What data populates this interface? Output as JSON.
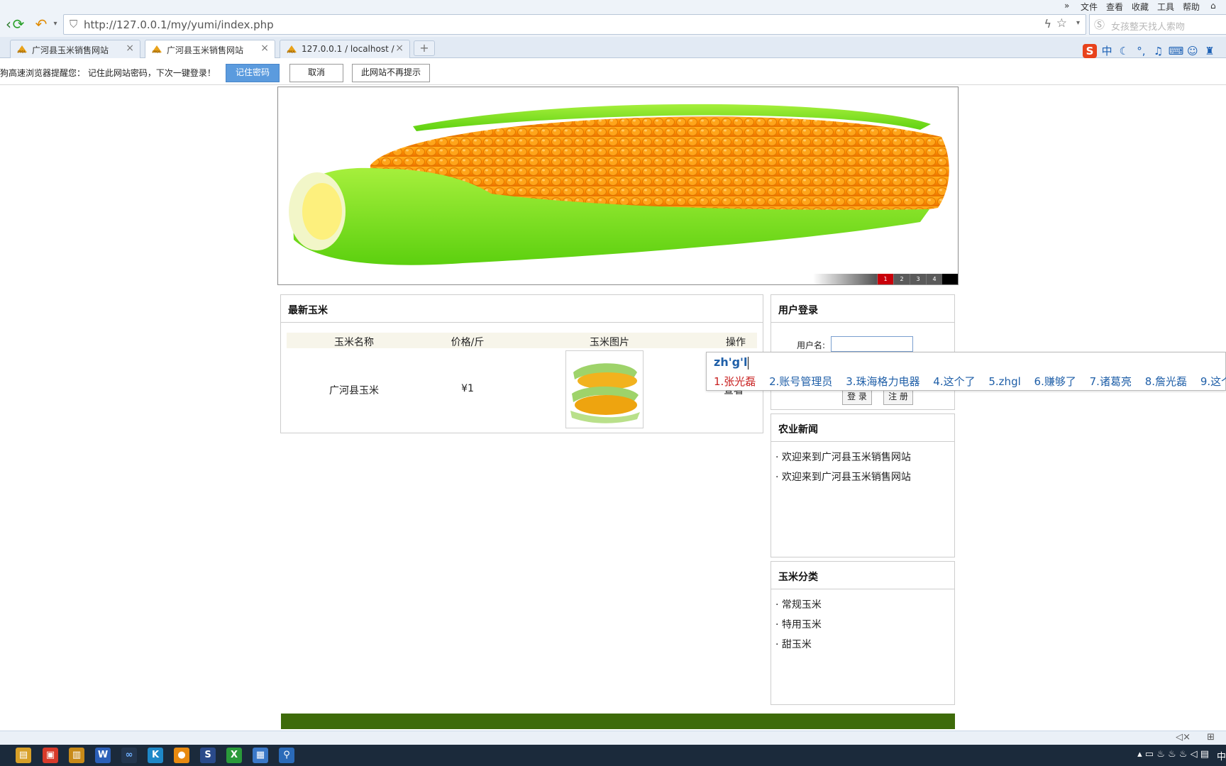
{
  "browser": {
    "menu": [
      "文件",
      "查看",
      "收藏",
      "工具",
      "帮助"
    ],
    "url": "http://127.0.0.1/my/yumi/index.php",
    "search_placeholder": "女孩整天找人索吻",
    "tabs": [
      {
        "label": "广河县玉米销售网站",
        "active": false
      },
      {
        "label": "广河县玉米销售网站",
        "active": true
      },
      {
        "label": "127.0.0.1 / localhost /",
        "active": false
      }
    ],
    "new_tab": "+"
  },
  "password_bar": {
    "message": "狗高速浏览器提醒您： 记住此网站密码，下次一键登录！",
    "remember": "记住密码",
    "cancel": "取消",
    "never": "此网站不再提示"
  },
  "banner": {
    "slides": [
      "1",
      "2",
      "3",
      "4"
    ],
    "active_slide": 1
  },
  "latest": {
    "title": "最新玉米",
    "columns": [
      "玉米名称",
      "价格/斤",
      "玉米图片",
      "操作"
    ],
    "rows": [
      {
        "name": "广河县玉米",
        "price": "¥1",
        "action": "查看"
      }
    ]
  },
  "login": {
    "title": "用户登录",
    "username_label": "用户名:",
    "login_button": "登 录",
    "register_button": "注 册"
  },
  "news": {
    "title": "农业新闻",
    "items": [
      "欢迎来到广河县玉米销售网站",
      "欢迎来到广河县玉米销售网站"
    ]
  },
  "categories": {
    "title": "玉米分类",
    "items": [
      "常规玉米",
      "特用玉米",
      "甜玉米"
    ]
  },
  "ime": {
    "composition": "zh'g'l",
    "candidates": [
      "1.张光磊",
      "2.账号管理员",
      "3.珠海格力电器",
      "4.这个了",
      "5.zhgl",
      "6.赚够了",
      "7.诸葛亮",
      "8.詹光磊",
      "9.这个"
    ]
  },
  "taskbar": {
    "ime_indicator": "中"
  },
  "colors": {
    "footer_green": "#3e6b0a",
    "active_slide": "#c8000a",
    "remember_button": "#5b9bde"
  }
}
